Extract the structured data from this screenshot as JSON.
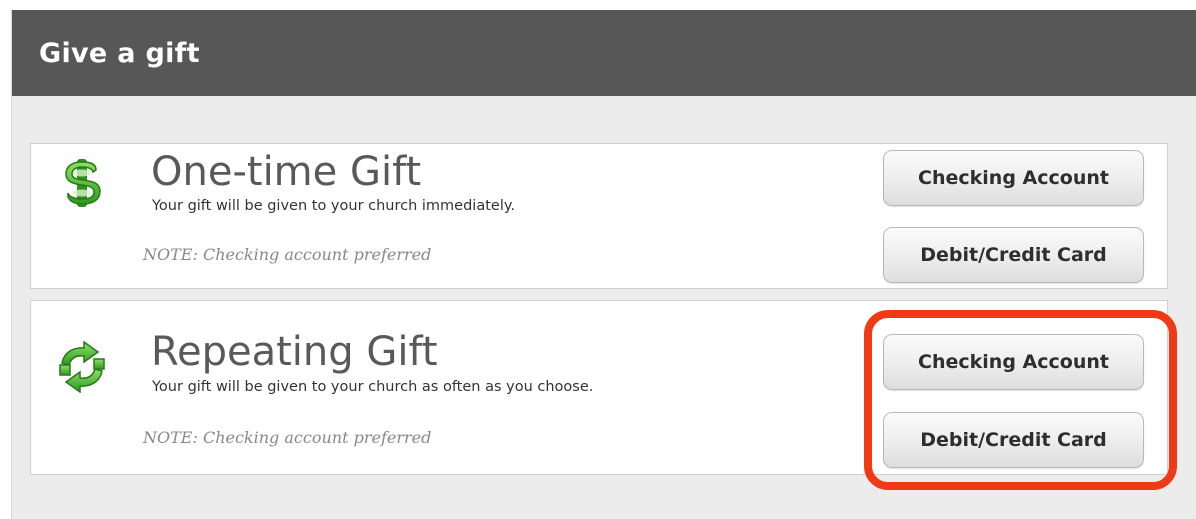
{
  "header": {
    "title": "Give a gift"
  },
  "options": [
    {
      "icon": "dollar-sign-icon",
      "title": "One-time Gift",
      "description": "Your gift will be given to your church immediately.",
      "note": "NOTE: Checking account preferred",
      "checking_label": "Checking Account",
      "card_label": "Debit/Credit Card"
    },
    {
      "icon": "refresh-arrows-icon",
      "title": "Repeating Gift",
      "description": "Your gift will be given to your church as often as you choose.",
      "note": "NOTE: Checking account preferred",
      "checking_label": "Checking Account",
      "card_label": "Debit/Credit Card"
    }
  ],
  "colors": {
    "header_bg": "#575757",
    "panel_bg": "#ececec",
    "icon_green": "#3fae2a",
    "highlight": "#f03a16"
  }
}
